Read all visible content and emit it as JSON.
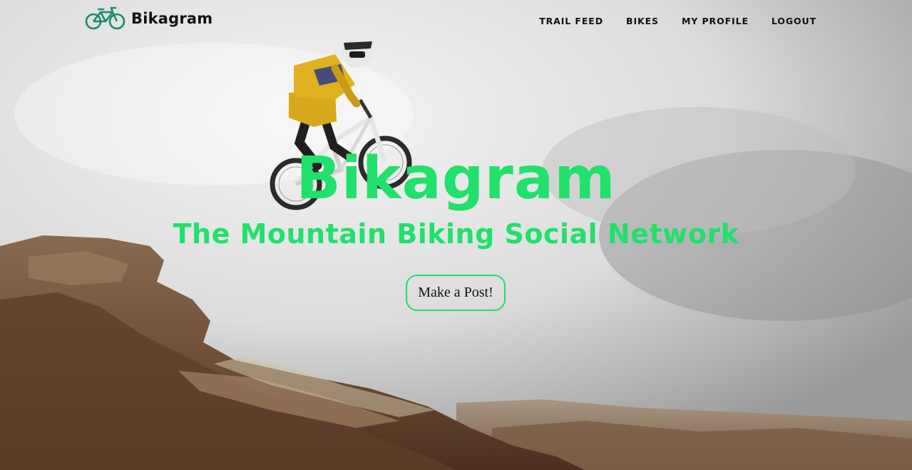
{
  "nav": {
    "brand_name": "Bikagram",
    "brand_icon": "bicycle-icon",
    "links": {
      "trail_feed": "TRAIL FEED",
      "bikes": "BIKES",
      "my_profile": "MY PROFILE",
      "logout": "LOGOUT"
    }
  },
  "hero": {
    "title": "Bikagram",
    "subtitle": "The Mountain Biking Social Network",
    "cta_label": "Make a Post!"
  },
  "colors": {
    "accent": "#21e06b",
    "nav_text": "#111111",
    "brand_icon": "#1a8a6e"
  }
}
